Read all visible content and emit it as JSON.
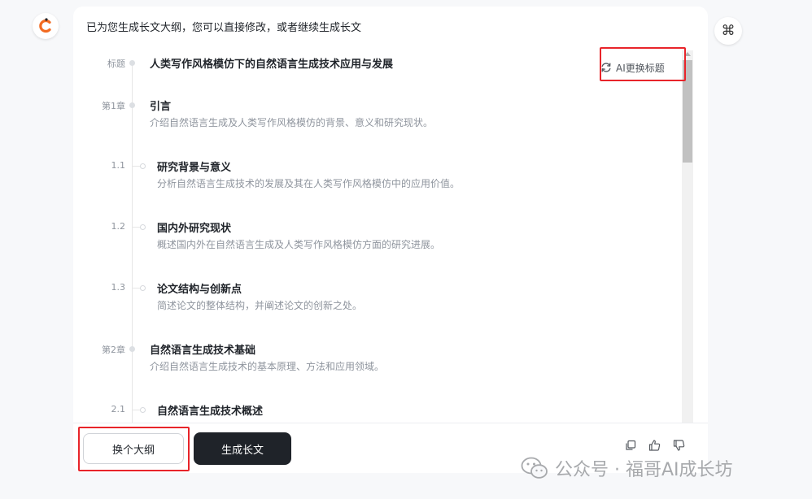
{
  "intro_text": "已为您生成长文大纲，您可以直接修改，或者继续生成长文",
  "refresh_title_label": "AI更换标题",
  "outline": [
    {
      "level": "title",
      "label": "标题",
      "title": "人类写作风格模仿下的自然语言生成技术应用与发展",
      "desc": ""
    },
    {
      "level": "chapter",
      "label": "第1章",
      "title": "引言",
      "desc": "介绍自然语言生成及人类写作风格模仿的背景、意义和研究现状。"
    },
    {
      "level": "section",
      "label": "1.1",
      "title": "研究背景与意义",
      "desc": "分析自然语言生成技术的发展及其在人类写作风格模仿中的应用价值。"
    },
    {
      "level": "section",
      "label": "1.2",
      "title": "国内外研究现状",
      "desc": "概述国内外在自然语言生成及人类写作风格模仿方面的研究进展。"
    },
    {
      "level": "section",
      "label": "1.3",
      "title": "论文结构与创新点",
      "desc": "简述论文的整体结构，并阐述论文的创新之处。"
    },
    {
      "level": "chapter",
      "label": "第2章",
      "title": "自然语言生成技术基础",
      "desc": "介绍自然语言生成技术的基本原理、方法和应用领域。"
    },
    {
      "level": "section",
      "label": "2.1",
      "title": "自然语言生成技术概述",
      "desc": ""
    }
  ],
  "buttons": {
    "change_outline": "换个大纲",
    "generate_long": "生成长文"
  },
  "watermark": "公众号 · 福哥AI成长坊",
  "icons": {
    "logo": "c-logo-icon",
    "command": "⌘",
    "refresh": "refresh-icon",
    "copy": "copy-icon",
    "thumbs_up": "thumbs-up-icon",
    "thumbs_down": "thumbs-down-icon",
    "wechat": "wechat-icon"
  },
  "colors": {
    "accent_orange": "#f26b22",
    "primary_dark": "#1f2329",
    "highlight_red": "#e8242a"
  }
}
